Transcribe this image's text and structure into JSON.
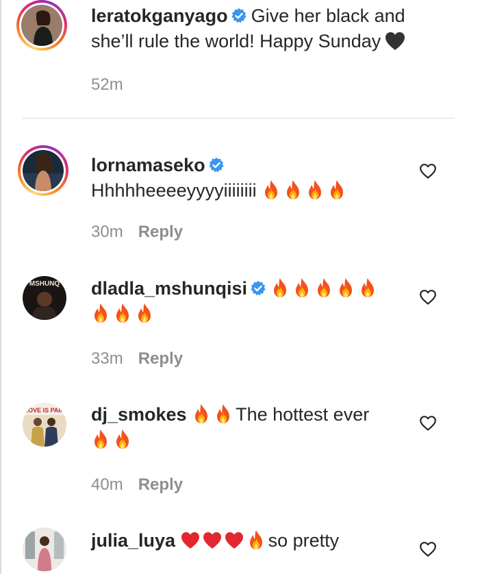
{
  "post": {
    "username": "leratokganyago",
    "caption": "Give her black and she’ll rule the world! Happy Sunday",
    "caption_emoji": "black-heart",
    "time": "52m"
  },
  "comments": [
    {
      "username": "lornamaseko",
      "verified": true,
      "text": "Hhhhheeeeyyyyiiiiiiii",
      "emojis": [
        "fire",
        "fire",
        "fire",
        "fire"
      ],
      "time": "30m",
      "reply_label": "Reply"
    },
    {
      "username": "dladla_mshunqisi",
      "verified": true,
      "text": "",
      "emojis": [
        "fire",
        "fire",
        "fire",
        "fire",
        "fire",
        "fire",
        "fire",
        "fire"
      ],
      "avatar_text": "MSHUNQ",
      "time": "33m",
      "reply_label": "Reply"
    },
    {
      "username": "dj_smokes",
      "verified": false,
      "text": "The hottest ever",
      "emojis": [
        "fire",
        "fire",
        "fire",
        "fire"
      ],
      "avatar_text": "LOVE IS PAIN",
      "time": "40m",
      "reply_label": "Reply"
    },
    {
      "username": "julia_luya",
      "verified": false,
      "text": "so pretty",
      "emojis": [
        "red-heart",
        "red-heart",
        "red-heart",
        "fire"
      ],
      "time": "",
      "reply_label": ""
    }
  ],
  "colors": {
    "text": "#262626",
    "muted": "#8e8e8e",
    "verified": "#3897f0",
    "divider": "#dbdbdb",
    "fire": "#f4511e"
  }
}
